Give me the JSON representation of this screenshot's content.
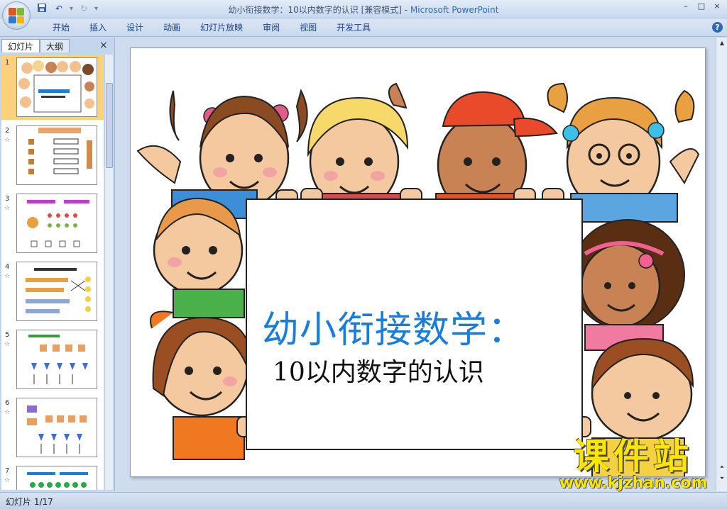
{
  "window": {
    "title": "幼小衔接数学：10以内数字的认识 [兼容模式] - ",
    "app_name": "Microsoft PowerPoint",
    "controls": [
      "–",
      "□",
      "×"
    ]
  },
  "quick_access": {
    "save_icon": "save-icon",
    "undo_icon": "undo-icon",
    "redo_icon": "redo-icon"
  },
  "ribbon": {
    "tabs": [
      "开始",
      "插入",
      "设计",
      "动画",
      "幻灯片放映",
      "审阅",
      "视图",
      "开发工具"
    ]
  },
  "left_panel": {
    "tabs": [
      "幻灯片",
      "大纲"
    ],
    "close": "×",
    "slides": [
      {
        "num": "1"
      },
      {
        "num": "2"
      },
      {
        "num": "3"
      },
      {
        "num": "4"
      },
      {
        "num": "5"
      },
      {
        "num": "6"
      },
      {
        "num": "7"
      }
    ],
    "star": "☆"
  },
  "slide": {
    "title": "幼小衔接数学：",
    "subtitle": "10以内数字的认识",
    "watermark_main": "课件站",
    "watermark_url": "www.kjzhan.com"
  },
  "status": {
    "slide_counter": "幻灯片 1/17"
  },
  "colors": {
    "title_blue": "#1a7cdb",
    "watermark_yellow": "#ffe600",
    "active_thumb": "#fbd27a"
  }
}
